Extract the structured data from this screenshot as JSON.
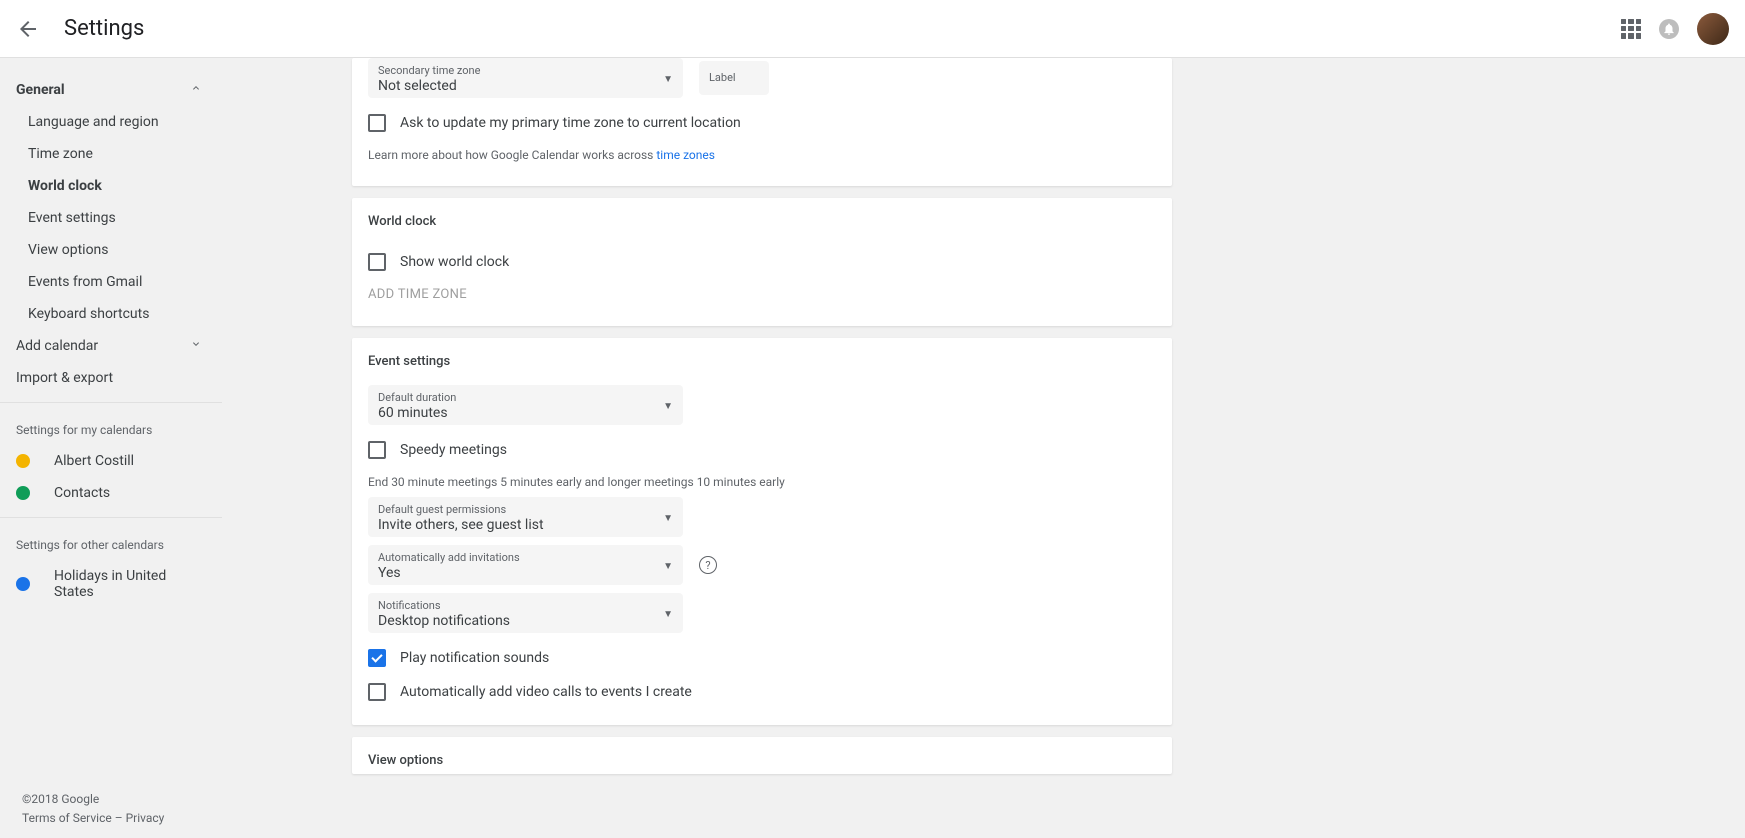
{
  "header": {
    "title": "Settings"
  },
  "sidebar": {
    "general": "General",
    "items": {
      "language": "Language and region",
      "timezone": "Time zone",
      "worldclock": "World clock",
      "eventsettings": "Event settings",
      "viewoptions": "View options",
      "gmail": "Events from Gmail",
      "shortcuts": "Keyboard shortcuts"
    },
    "addcalendar": "Add calendar",
    "importexport": "Import & export",
    "mycalendars_label": "Settings for my calendars",
    "mycalendars": [
      {
        "name": "Albert Costill",
        "color": "#f4b400"
      },
      {
        "name": "Contacts",
        "color": "#0f9d58"
      }
    ],
    "othercalendars_label": "Settings for other calendars",
    "othercalendars": [
      {
        "name": "Holidays in United States",
        "color": "#1a73e8"
      }
    ]
  },
  "tz": {
    "secondary_label": "Secondary time zone",
    "secondary_value": "Not selected",
    "label_label": "Label",
    "ask_update": "Ask to update my primary time zone to current location",
    "learn_more_pre": "Learn more about how Google Calendar works across ",
    "learn_more_link": "time zones"
  },
  "worldclock": {
    "title": "World clock",
    "show": "Show world clock",
    "add": "ADD TIME ZONE"
  },
  "eventsettings": {
    "title": "Event settings",
    "duration_label": "Default duration",
    "duration_value": "60 minutes",
    "speedy": "Speedy meetings",
    "speedy_hint": "End 30 minute meetings 5 minutes early and longer meetings 10 minutes early",
    "perms_label": "Default guest permissions",
    "perms_value": "Invite others, see guest list",
    "autoinvite_label": "Automatically add invitations",
    "autoinvite_value": "Yes",
    "notif_label": "Notifications",
    "notif_value": "Desktop notifications",
    "play_sounds": "Play notification sounds",
    "auto_video": "Automatically add video calls to events I create"
  },
  "viewoptions": {
    "title": "View options"
  },
  "footer": {
    "copyright": "©2018 Google",
    "terms": "Terms of Service",
    "sep": " – ",
    "privacy": "Privacy"
  }
}
